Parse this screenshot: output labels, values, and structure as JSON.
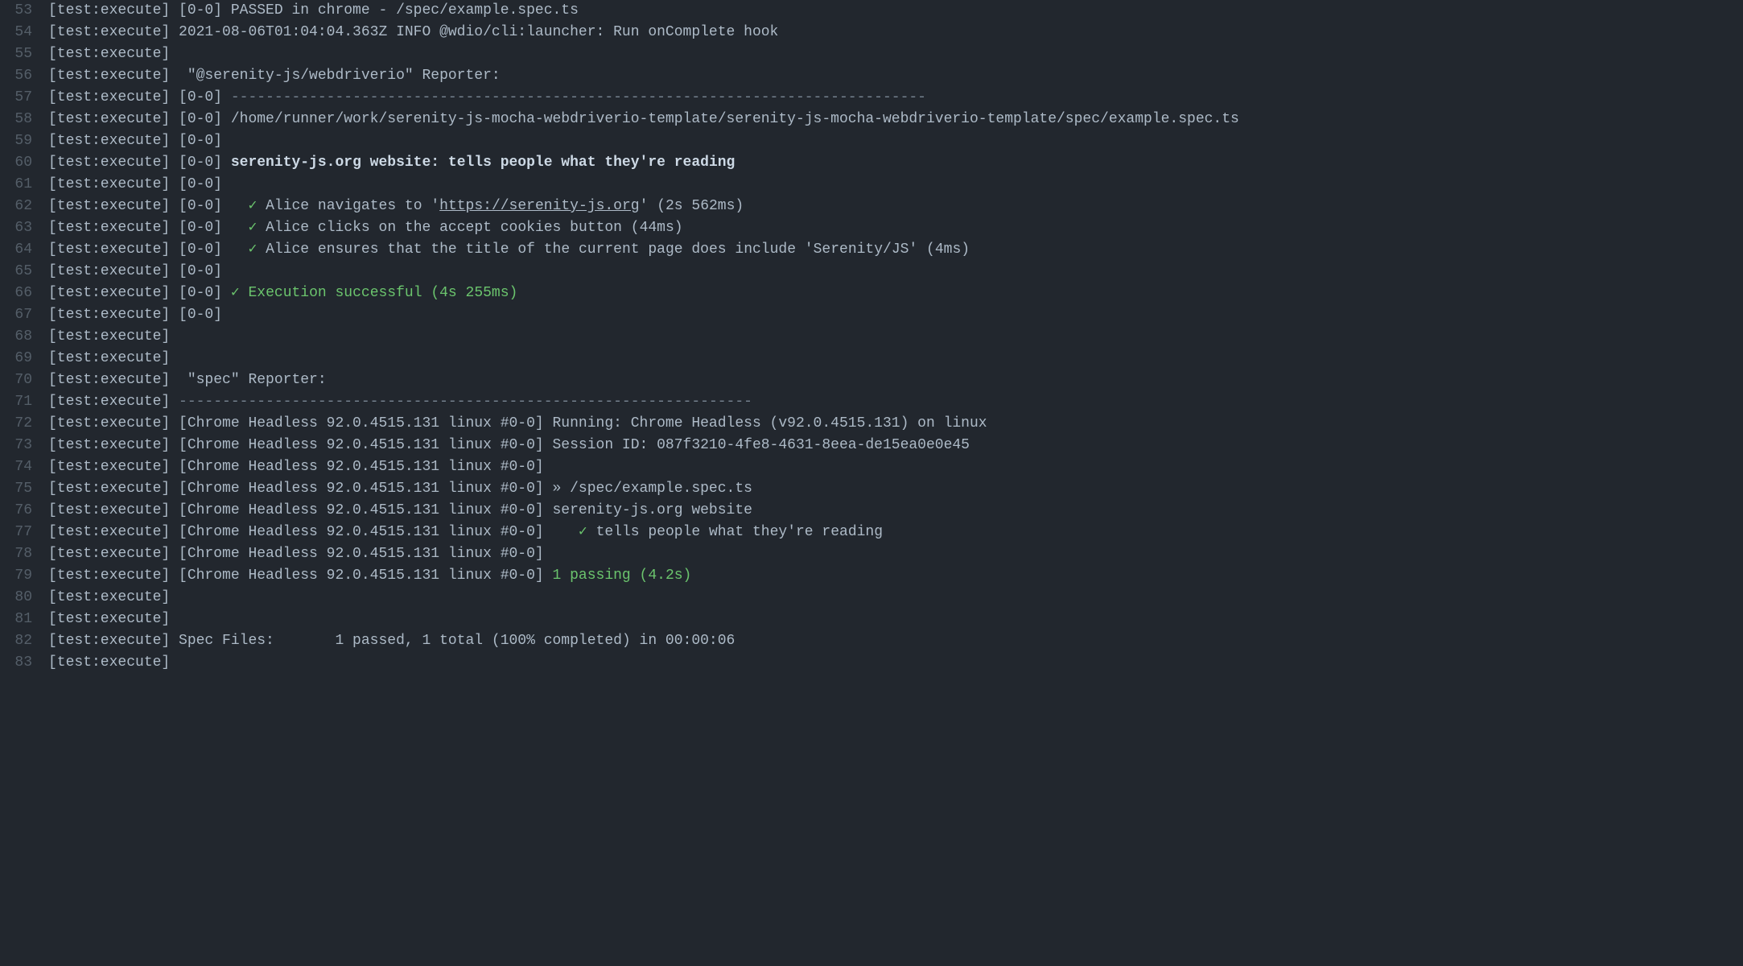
{
  "lines": [
    {
      "num": 53,
      "segments": [
        {
          "t": "[test:execute] [0-0] PASSED in chrome - /spec/example.spec.ts",
          "cls": ""
        }
      ]
    },
    {
      "num": 54,
      "segments": [
        {
          "t": "[test:execute] 2021-08-06T01:04:04.363Z INFO @wdio/cli:launcher: Run onComplete hook",
          "cls": ""
        }
      ]
    },
    {
      "num": 55,
      "segments": [
        {
          "t": "[test:execute]",
          "cls": ""
        }
      ]
    },
    {
      "num": 56,
      "segments": [
        {
          "t": "[test:execute]  \"@serenity-js/webdriverio\" Reporter:",
          "cls": ""
        }
      ]
    },
    {
      "num": 57,
      "segments": [
        {
          "t": "[test:execute] [0-0] ",
          "cls": ""
        },
        {
          "t": "--------------------------------------------------------------------------------",
          "cls": "dim"
        }
      ]
    },
    {
      "num": 58,
      "segments": [
        {
          "t": "[test:execute] [0-0] /home/runner/work/serenity-js-mocha-webdriverio-template/serenity-js-mocha-webdriverio-template/spec/example.spec.ts",
          "cls": ""
        }
      ]
    },
    {
      "num": 59,
      "segments": [
        {
          "t": "[test:execute] [0-0]",
          "cls": ""
        }
      ]
    },
    {
      "num": 60,
      "segments": [
        {
          "t": "[test:execute] [0-0] ",
          "cls": ""
        },
        {
          "t": "serenity-js.org website: tells people what they're reading",
          "cls": "bold"
        }
      ]
    },
    {
      "num": 61,
      "segments": [
        {
          "t": "[test:execute] [0-0]",
          "cls": ""
        }
      ]
    },
    {
      "num": 62,
      "segments": [
        {
          "t": "[test:execute] [0-0]   ",
          "cls": ""
        },
        {
          "t": "✓",
          "cls": "check"
        },
        {
          "t": " Alice navigates to '",
          "cls": ""
        },
        {
          "t": "https://serenity-js.org",
          "cls": "underline"
        },
        {
          "t": "' (2s 562ms)",
          "cls": ""
        }
      ]
    },
    {
      "num": 63,
      "segments": [
        {
          "t": "[test:execute] [0-0]   ",
          "cls": ""
        },
        {
          "t": "✓",
          "cls": "check"
        },
        {
          "t": " Alice clicks on the accept cookies button (44ms)",
          "cls": ""
        }
      ]
    },
    {
      "num": 64,
      "segments": [
        {
          "t": "[test:execute] [0-0]   ",
          "cls": ""
        },
        {
          "t": "✓",
          "cls": "check"
        },
        {
          "t": " Alice ensures that the title of the current page does include 'Serenity/JS' (4ms)",
          "cls": ""
        }
      ]
    },
    {
      "num": 65,
      "segments": [
        {
          "t": "[test:execute] [0-0]",
          "cls": ""
        }
      ]
    },
    {
      "num": 66,
      "segments": [
        {
          "t": "[test:execute] [0-0] ",
          "cls": ""
        },
        {
          "t": "✓ Execution successful (4s 255ms)",
          "cls": "success"
        }
      ]
    },
    {
      "num": 67,
      "segments": [
        {
          "t": "[test:execute] [0-0]",
          "cls": ""
        }
      ]
    },
    {
      "num": 68,
      "segments": [
        {
          "t": "[test:execute]",
          "cls": ""
        }
      ]
    },
    {
      "num": 69,
      "segments": [
        {
          "t": "[test:execute]",
          "cls": ""
        }
      ]
    },
    {
      "num": 70,
      "segments": [
        {
          "t": "[test:execute]  \"spec\" Reporter:",
          "cls": ""
        }
      ]
    },
    {
      "num": 71,
      "segments": [
        {
          "t": "[test:execute] ",
          "cls": ""
        },
        {
          "t": "------------------------------------------------------------------",
          "cls": "dim"
        }
      ]
    },
    {
      "num": 72,
      "segments": [
        {
          "t": "[test:execute] [Chrome Headless 92.0.4515.131 linux #0-0] Running: Chrome Headless (v92.0.4515.131) on linux",
          "cls": ""
        }
      ]
    },
    {
      "num": 73,
      "segments": [
        {
          "t": "[test:execute] [Chrome Headless 92.0.4515.131 linux #0-0] Session ID: 087f3210-4fe8-4631-8eea-de15ea0e0e45",
          "cls": ""
        }
      ]
    },
    {
      "num": 74,
      "segments": [
        {
          "t": "[test:execute] [Chrome Headless 92.0.4515.131 linux #0-0]",
          "cls": ""
        }
      ]
    },
    {
      "num": 75,
      "segments": [
        {
          "t": "[test:execute] [Chrome Headless 92.0.4515.131 linux #0-0] » /spec/example.spec.ts",
          "cls": ""
        }
      ]
    },
    {
      "num": 76,
      "segments": [
        {
          "t": "[test:execute] [Chrome Headless 92.0.4515.131 linux #0-0] serenity-js.org website",
          "cls": ""
        }
      ]
    },
    {
      "num": 77,
      "segments": [
        {
          "t": "[test:execute] [Chrome Headless 92.0.4515.131 linux #0-0]    ",
          "cls": ""
        },
        {
          "t": "✓",
          "cls": "check"
        },
        {
          "t": " tells people what they're reading",
          "cls": ""
        }
      ]
    },
    {
      "num": 78,
      "segments": [
        {
          "t": "[test:execute] [Chrome Headless 92.0.4515.131 linux #0-0]",
          "cls": ""
        }
      ]
    },
    {
      "num": 79,
      "segments": [
        {
          "t": "[test:execute] [Chrome Headless 92.0.4515.131 linux #0-0] ",
          "cls": ""
        },
        {
          "t": "1 passing (4.2s)",
          "cls": "success"
        }
      ]
    },
    {
      "num": 80,
      "segments": [
        {
          "t": "[test:execute]",
          "cls": ""
        }
      ]
    },
    {
      "num": 81,
      "segments": [
        {
          "t": "[test:execute]",
          "cls": ""
        }
      ]
    },
    {
      "num": 82,
      "segments": [
        {
          "t": "[test:execute] Spec Files:\t 1 passed, 1 total (100% completed) in 00:00:06",
          "cls": ""
        }
      ]
    },
    {
      "num": 83,
      "segments": [
        {
          "t": "[test:execute]",
          "cls": ""
        }
      ]
    }
  ]
}
